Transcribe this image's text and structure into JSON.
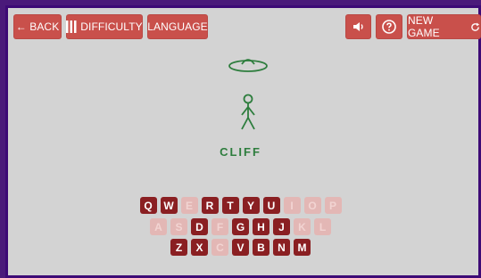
{
  "toolbar": {
    "back_label": "← BACK",
    "difficulty_label": "DIFFICULTY",
    "language_label": "LANGUAGE",
    "new_game_label": "NEW GAME"
  },
  "icons": {
    "back": "arrow-left-icon",
    "difficulty": "bars-icon",
    "sound": "speaker-icon",
    "help": "help-circle-icon",
    "new_game": "refresh-icon"
  },
  "game": {
    "word": "CLIFF",
    "figure": "stick-figure-with-ufo"
  },
  "keyboard": {
    "rows": [
      [
        {
          "letter": "Q",
          "state": "active"
        },
        {
          "letter": "W",
          "state": "active"
        },
        {
          "letter": "E",
          "state": "used"
        },
        {
          "letter": "R",
          "state": "active"
        },
        {
          "letter": "T",
          "state": "active"
        },
        {
          "letter": "Y",
          "state": "active"
        },
        {
          "letter": "U",
          "state": "active"
        },
        {
          "letter": "I",
          "state": "used"
        },
        {
          "letter": "O",
          "state": "used"
        },
        {
          "letter": "P",
          "state": "used"
        }
      ],
      [
        {
          "letter": "A",
          "state": "used"
        },
        {
          "letter": "S",
          "state": "used"
        },
        {
          "letter": "D",
          "state": "active"
        },
        {
          "letter": "F",
          "state": "used"
        },
        {
          "letter": "G",
          "state": "active"
        },
        {
          "letter": "H",
          "state": "active"
        },
        {
          "letter": "J",
          "state": "active"
        },
        {
          "letter": "K",
          "state": "used"
        },
        {
          "letter": "L",
          "state": "used"
        }
      ],
      [
        {
          "letter": "Z",
          "state": "active"
        },
        {
          "letter": "X",
          "state": "active"
        },
        {
          "letter": "C",
          "state": "used"
        },
        {
          "letter": "V",
          "state": "active"
        },
        {
          "letter": "B",
          "state": "active"
        },
        {
          "letter": "N",
          "state": "active"
        },
        {
          "letter": "M",
          "state": "active"
        }
      ]
    ]
  },
  "colors": {
    "button": "#c9504b",
    "key_active": "#8a1f22",
    "key_used": "#e3b7b5",
    "word": "#2d7d3d",
    "frame": "#3d0a76",
    "background": "#d3d3d3"
  }
}
